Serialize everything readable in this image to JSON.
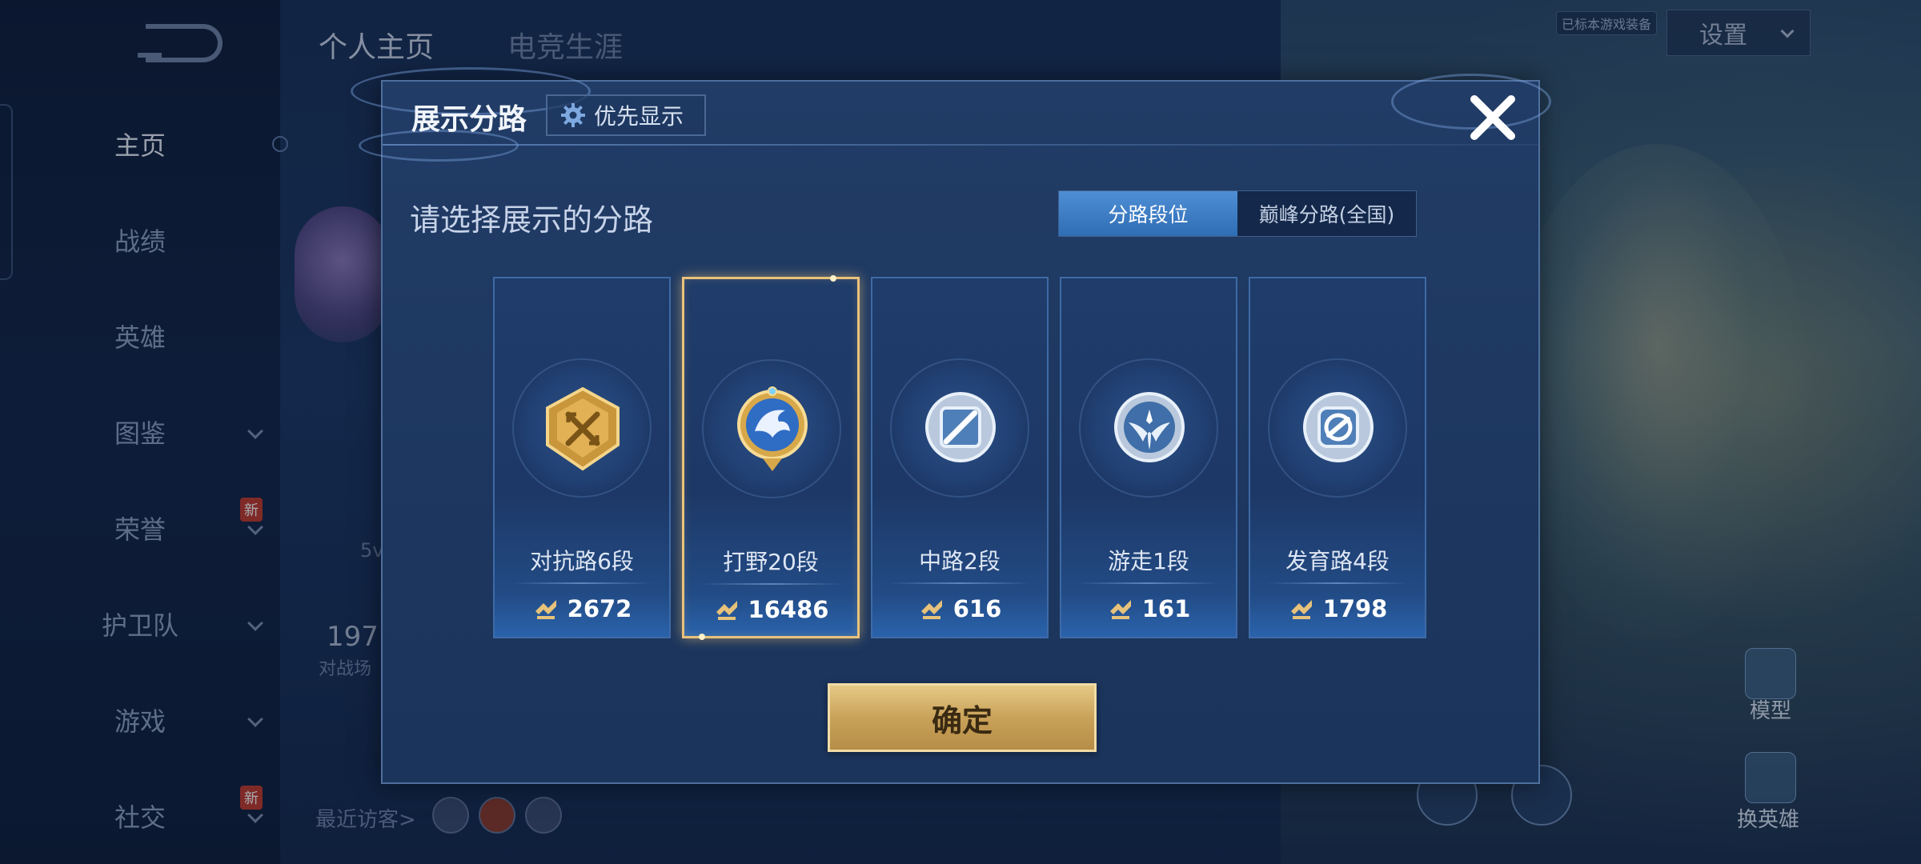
{
  "sidebar": {
    "items": [
      {
        "label": "主页",
        "active": true
      },
      {
        "label": "战绩"
      },
      {
        "label": "英雄"
      },
      {
        "label": "图鉴",
        "chevron": true
      },
      {
        "label": "荣誉",
        "chevron": true,
        "badge": "新"
      },
      {
        "label": "护卫队",
        "chevron": true
      },
      {
        "label": "游戏",
        "chevron": true
      },
      {
        "label": "社交",
        "chevron": true,
        "badge": "新"
      }
    ]
  },
  "background": {
    "tabs": [
      "个人主页",
      "电竞生涯"
    ],
    "settings_label": "设置",
    "small_tag": "已标本游戏装备",
    "stat_partial": "5v",
    "count_partial": "197",
    "count_sub_partial": "对战场",
    "recent_visitors_label": "最近访客>",
    "right_actions": [
      "模型",
      "换英雄"
    ]
  },
  "modal": {
    "title": "展示分路",
    "priority_button_label": "优先显示",
    "subtitle": "请选择展示的分路",
    "toggle": [
      {
        "label": "分路段位",
        "active": true
      },
      {
        "label": "巅峰分路(全国)",
        "active": false
      }
    ],
    "lanes": [
      {
        "name": "对抗路6段",
        "score": "2672",
        "selected": false
      },
      {
        "name": "打野20段",
        "score": "16486",
        "selected": true
      },
      {
        "name": "中路2段",
        "score": "616",
        "selected": false
      },
      {
        "name": "游走1段",
        "score": "161",
        "selected": false
      },
      {
        "name": "发育路4段",
        "score": "1798",
        "selected": false
      }
    ],
    "confirm_label": "确定"
  },
  "colors": {
    "selected_border": "#e9c27a",
    "toggle_active": "#3f7ec6",
    "confirm_gold": "#c9a25a"
  },
  "icons": [
    "gear-icon",
    "close-icon",
    "points-icon",
    "lane-emblem-icon"
  ]
}
